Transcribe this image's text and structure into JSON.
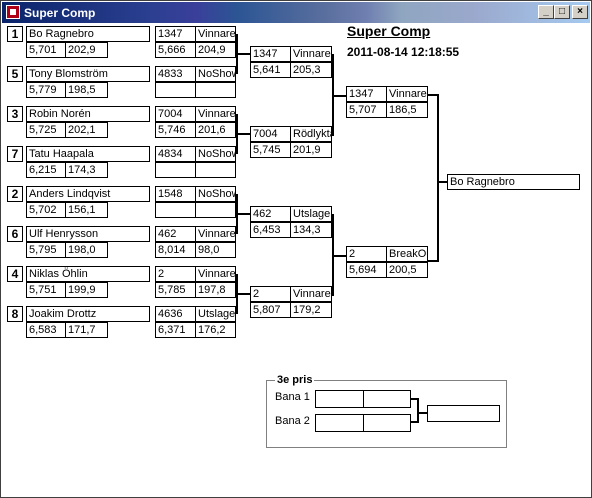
{
  "window": {
    "title": "Super Comp",
    "buttons": [
      "_",
      "□",
      "×"
    ]
  },
  "header": {
    "title": "Super Comp",
    "datetime": "2011-08-14 12:18:55"
  },
  "round1": [
    {
      "seed": "1",
      "name": "Bo Ragnebro",
      "rt": "5,701",
      "speed": "202,9"
    },
    {
      "seed": "5",
      "name": "Tony Blomström",
      "rt": "5,779",
      "speed": "198,5"
    },
    {
      "seed": "3",
      "name": "Robin Norén",
      "rt": "5,725",
      "speed": "202,1"
    },
    {
      "seed": "7",
      "name": "Tatu Haapala",
      "rt": "6,215",
      "speed": "174,3"
    },
    {
      "seed": "2",
      "name": "Anders Lindqvist",
      "rt": "5,702",
      "speed": "156,1"
    },
    {
      "seed": "6",
      "name": "Ulf Henrysson",
      "rt": "5,795",
      "speed": "198,0"
    },
    {
      "seed": "4",
      "name": "Niklas Öhlin",
      "rt": "5,751",
      "speed": "199,9"
    },
    {
      "seed": "8",
      "name": "Joakim Drottz",
      "rt": "6,583",
      "speed": "171,7"
    }
  ],
  "round1_results": [
    {
      "id": "1347",
      "status": "Vinnare",
      "rt": "5,666",
      "speed": "204,9"
    },
    {
      "id": "4833",
      "status": "NoShow",
      "rt": "",
      "speed": ""
    },
    {
      "id": "7004",
      "status": "Vinnare",
      "rt": "5,746",
      "speed": "201,6"
    },
    {
      "id": "4834",
      "status": "NoShow",
      "rt": "",
      "speed": ""
    },
    {
      "id": "1548",
      "status": "NoShow",
      "rt": "",
      "speed": ""
    },
    {
      "id": "462",
      "status": "Vinnare",
      "rt": "8,014",
      "speed": "98,0"
    },
    {
      "id": "2",
      "status": "Vinnare",
      "rt": "5,785",
      "speed": "197,8"
    },
    {
      "id": "4636",
      "status": "Utslagen",
      "rt": "6,371",
      "speed": "176,2"
    }
  ],
  "round2": [
    {
      "id": "1347",
      "status": "Vinnare",
      "rt": "5,641",
      "speed": "205,3"
    },
    {
      "id": "7004",
      "status": "Rödlyktan",
      "rt": "5,745",
      "speed": "201,9"
    },
    {
      "id": "462",
      "status": "Utslagen",
      "rt": "6,453",
      "speed": "134,3"
    },
    {
      "id": "2",
      "status": "Vinnare",
      "rt": "5,807",
      "speed": "179,2"
    }
  ],
  "round3": [
    {
      "id": "1347",
      "status": "Vinnare",
      "rt": "5,707",
      "speed": "186,5"
    },
    {
      "id": "2",
      "status": "BreakOut",
      "rt": "5,694",
      "speed": "200,5"
    }
  ],
  "winner": "Bo Ragnebro",
  "third_place": {
    "title": "3e pris",
    "lane1_label": "Bana 1",
    "lane2_label": "Bana 2"
  }
}
